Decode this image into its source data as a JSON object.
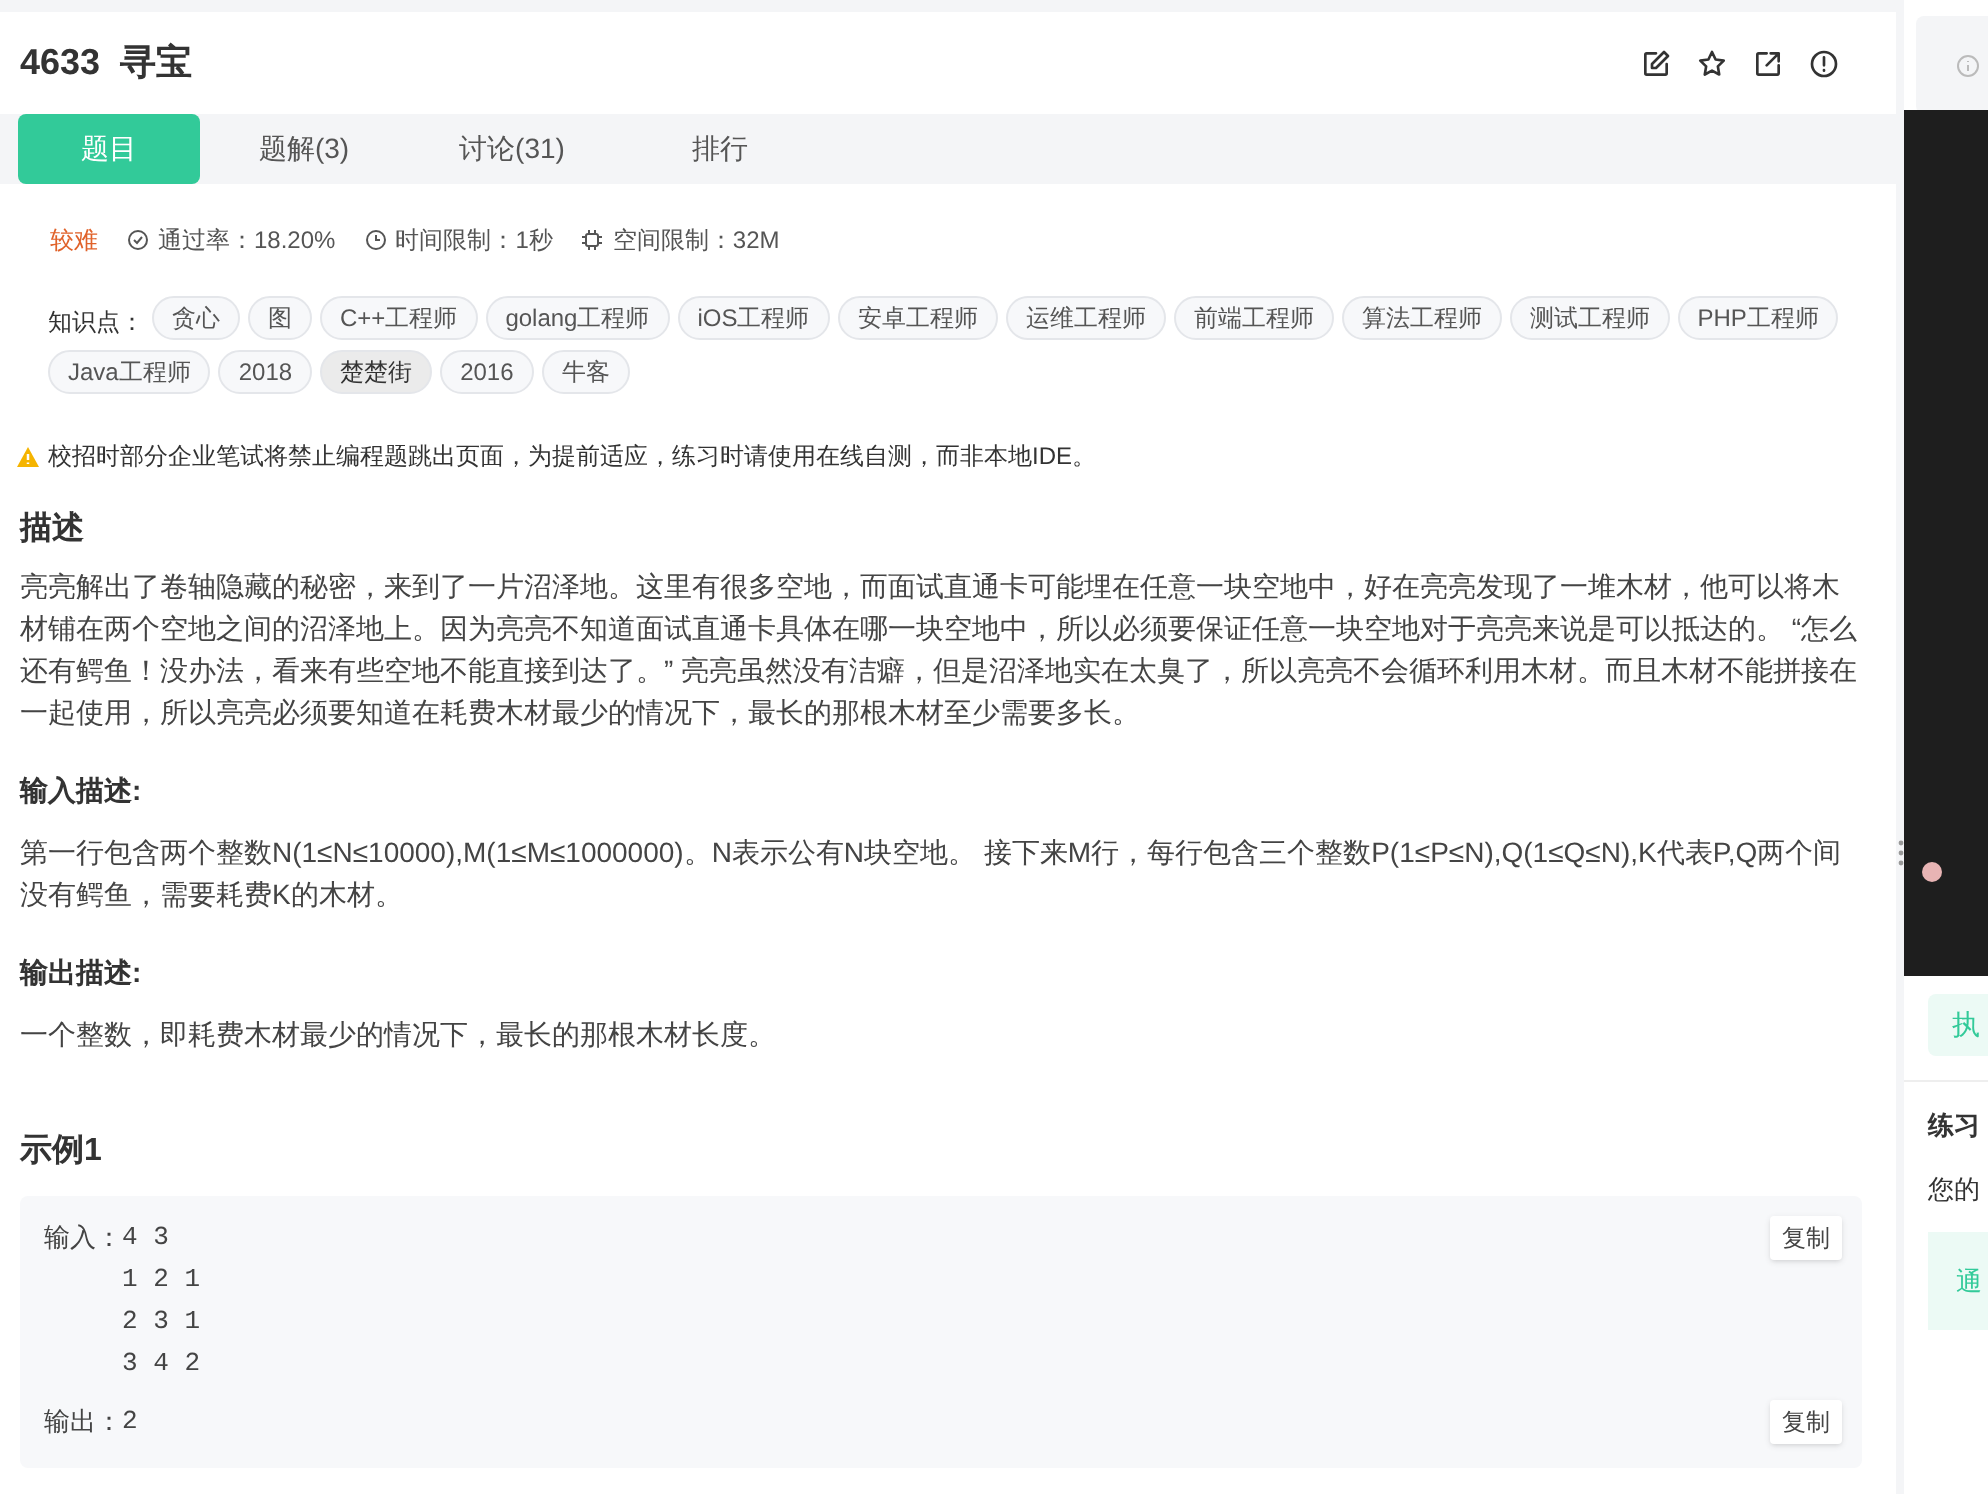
{
  "problem": {
    "title": "4633  寻宝"
  },
  "tabs": [
    {
      "label": "题目",
      "selected": true
    },
    {
      "label": "题解(3)",
      "selected": false
    },
    {
      "label": "讨论(31)",
      "selected": false
    },
    {
      "label": "排行",
      "selected": false
    }
  ],
  "meta": {
    "difficulty": "较难",
    "pass_rate": "通过率：18.20%",
    "time_limit": "时间限制：1秒",
    "space_limit": "空间限制：32M"
  },
  "tags_label": "知识点：",
  "tags": [
    {
      "label": "贪心",
      "selected": false
    },
    {
      "label": "图",
      "selected": false
    },
    {
      "label": "C++工程师",
      "selected": false
    },
    {
      "label": "golang工程师",
      "selected": false
    },
    {
      "label": "iOS工程师",
      "selected": false
    },
    {
      "label": "安卓工程师",
      "selected": false
    },
    {
      "label": "运维工程师",
      "selected": false
    },
    {
      "label": "前端工程师",
      "selected": false
    },
    {
      "label": "算法工程师",
      "selected": false
    },
    {
      "label": "测试工程师",
      "selected": false
    },
    {
      "label": "PHP工程师",
      "selected": false
    },
    {
      "label": "Java工程师",
      "selected": false
    },
    {
      "label": "2018",
      "selected": false
    },
    {
      "label": "楚楚街",
      "selected": true
    },
    {
      "label": "2016",
      "selected": false
    },
    {
      "label": "牛客",
      "selected": false
    }
  ],
  "notice": "校招时部分企业笔试将禁止编程题跳出页面，为提前适应，练习时请使用在线自测，而非本地IDE。",
  "sections": [
    {
      "kind": "heading",
      "text": "描述"
    },
    {
      "kind": "paragraph",
      "text": "亮亮解出了卷轴隐藏的秘密，来到了一片沼泽地。这里有很多空地，而面试直通卡可能埋在任意一块空地中，好在亮亮发现了一堆木材，他可以将木材铺在两个空地之间的沼泽地上。因为亮亮不知道面试直通卡具体在哪一块空地中，所以必须要保证任意一块空地对于亮亮来说是可以抵达的。 “怎么还有鳄鱼！没办法，看来有些空地不能直接到达了。” 亮亮虽然没有洁癖，但是沼泽地实在太臭了，所以亮亮不会循环利用木材。而且木材不能拼接在一起使用，所以亮亮必须要知道在耗费木材最少的情况下，最长的那根木材至少需要多长。"
    },
    {
      "kind": "subheading",
      "text": "输入描述:"
    },
    {
      "kind": "paragraph",
      "text": "第一行包含两个整数N(1≤N≤10000),M(1≤M≤1000000)。N表示公有N块空地。 接下来M行，每行包含三个整数P(1≤P≤N),Q(1≤Q≤N),K代表P,Q两个间没有鳄鱼，需要耗费K的木材。"
    },
    {
      "kind": "subheading",
      "text": "输出描述:"
    },
    {
      "kind": "paragraph",
      "text": "一个整数，即耗费木材最少的情况下，最长的那根木材长度。"
    }
  ],
  "example": {
    "title": "示例1",
    "input_label": "输入：",
    "input_lines": [
      "4 3",
      "1 2 1",
      "2 3 1",
      "3 4 2"
    ],
    "output_label": "输出：",
    "output_lines": [
      "2"
    ],
    "input_copy": "复制",
    "output_copy": "复制"
  },
  "side_panel": {
    "run_button": "执",
    "practice_title": "练习",
    "practice_text": "您的",
    "status_box": "通"
  }
}
